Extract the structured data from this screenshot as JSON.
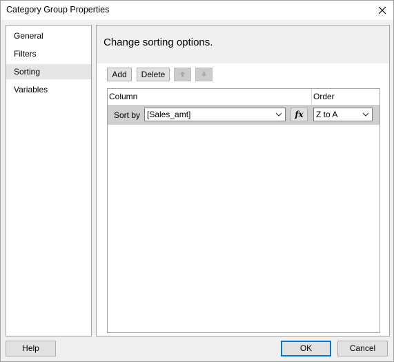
{
  "window": {
    "title": "Category Group Properties"
  },
  "nav": {
    "items": [
      "General",
      "Filters",
      "Sorting",
      "Variables"
    ],
    "active": "Sorting"
  },
  "header": {
    "text": "Change sorting options."
  },
  "toolbar": {
    "add_label": "Add",
    "delete_label": "Delete"
  },
  "grid": {
    "columns": [
      "Column",
      "Order"
    ],
    "rows": [
      {
        "label": "Sort by",
        "column": "[Sales_amt]",
        "order": "Z to A"
      }
    ]
  },
  "footer": {
    "help_label": "Help",
    "ok_label": "OK",
    "cancel_label": "Cancel"
  },
  "icons": {
    "close": "close-icon",
    "move_up": "arrow-up-icon",
    "move_down": "arrow-down-icon",
    "expression": "function-icon",
    "dropdown": "chevron-down-icon"
  },
  "colors": {
    "accent": "#0078d7",
    "selected_row": "#cfcfcf",
    "nav_active": "#e5e5e5"
  }
}
